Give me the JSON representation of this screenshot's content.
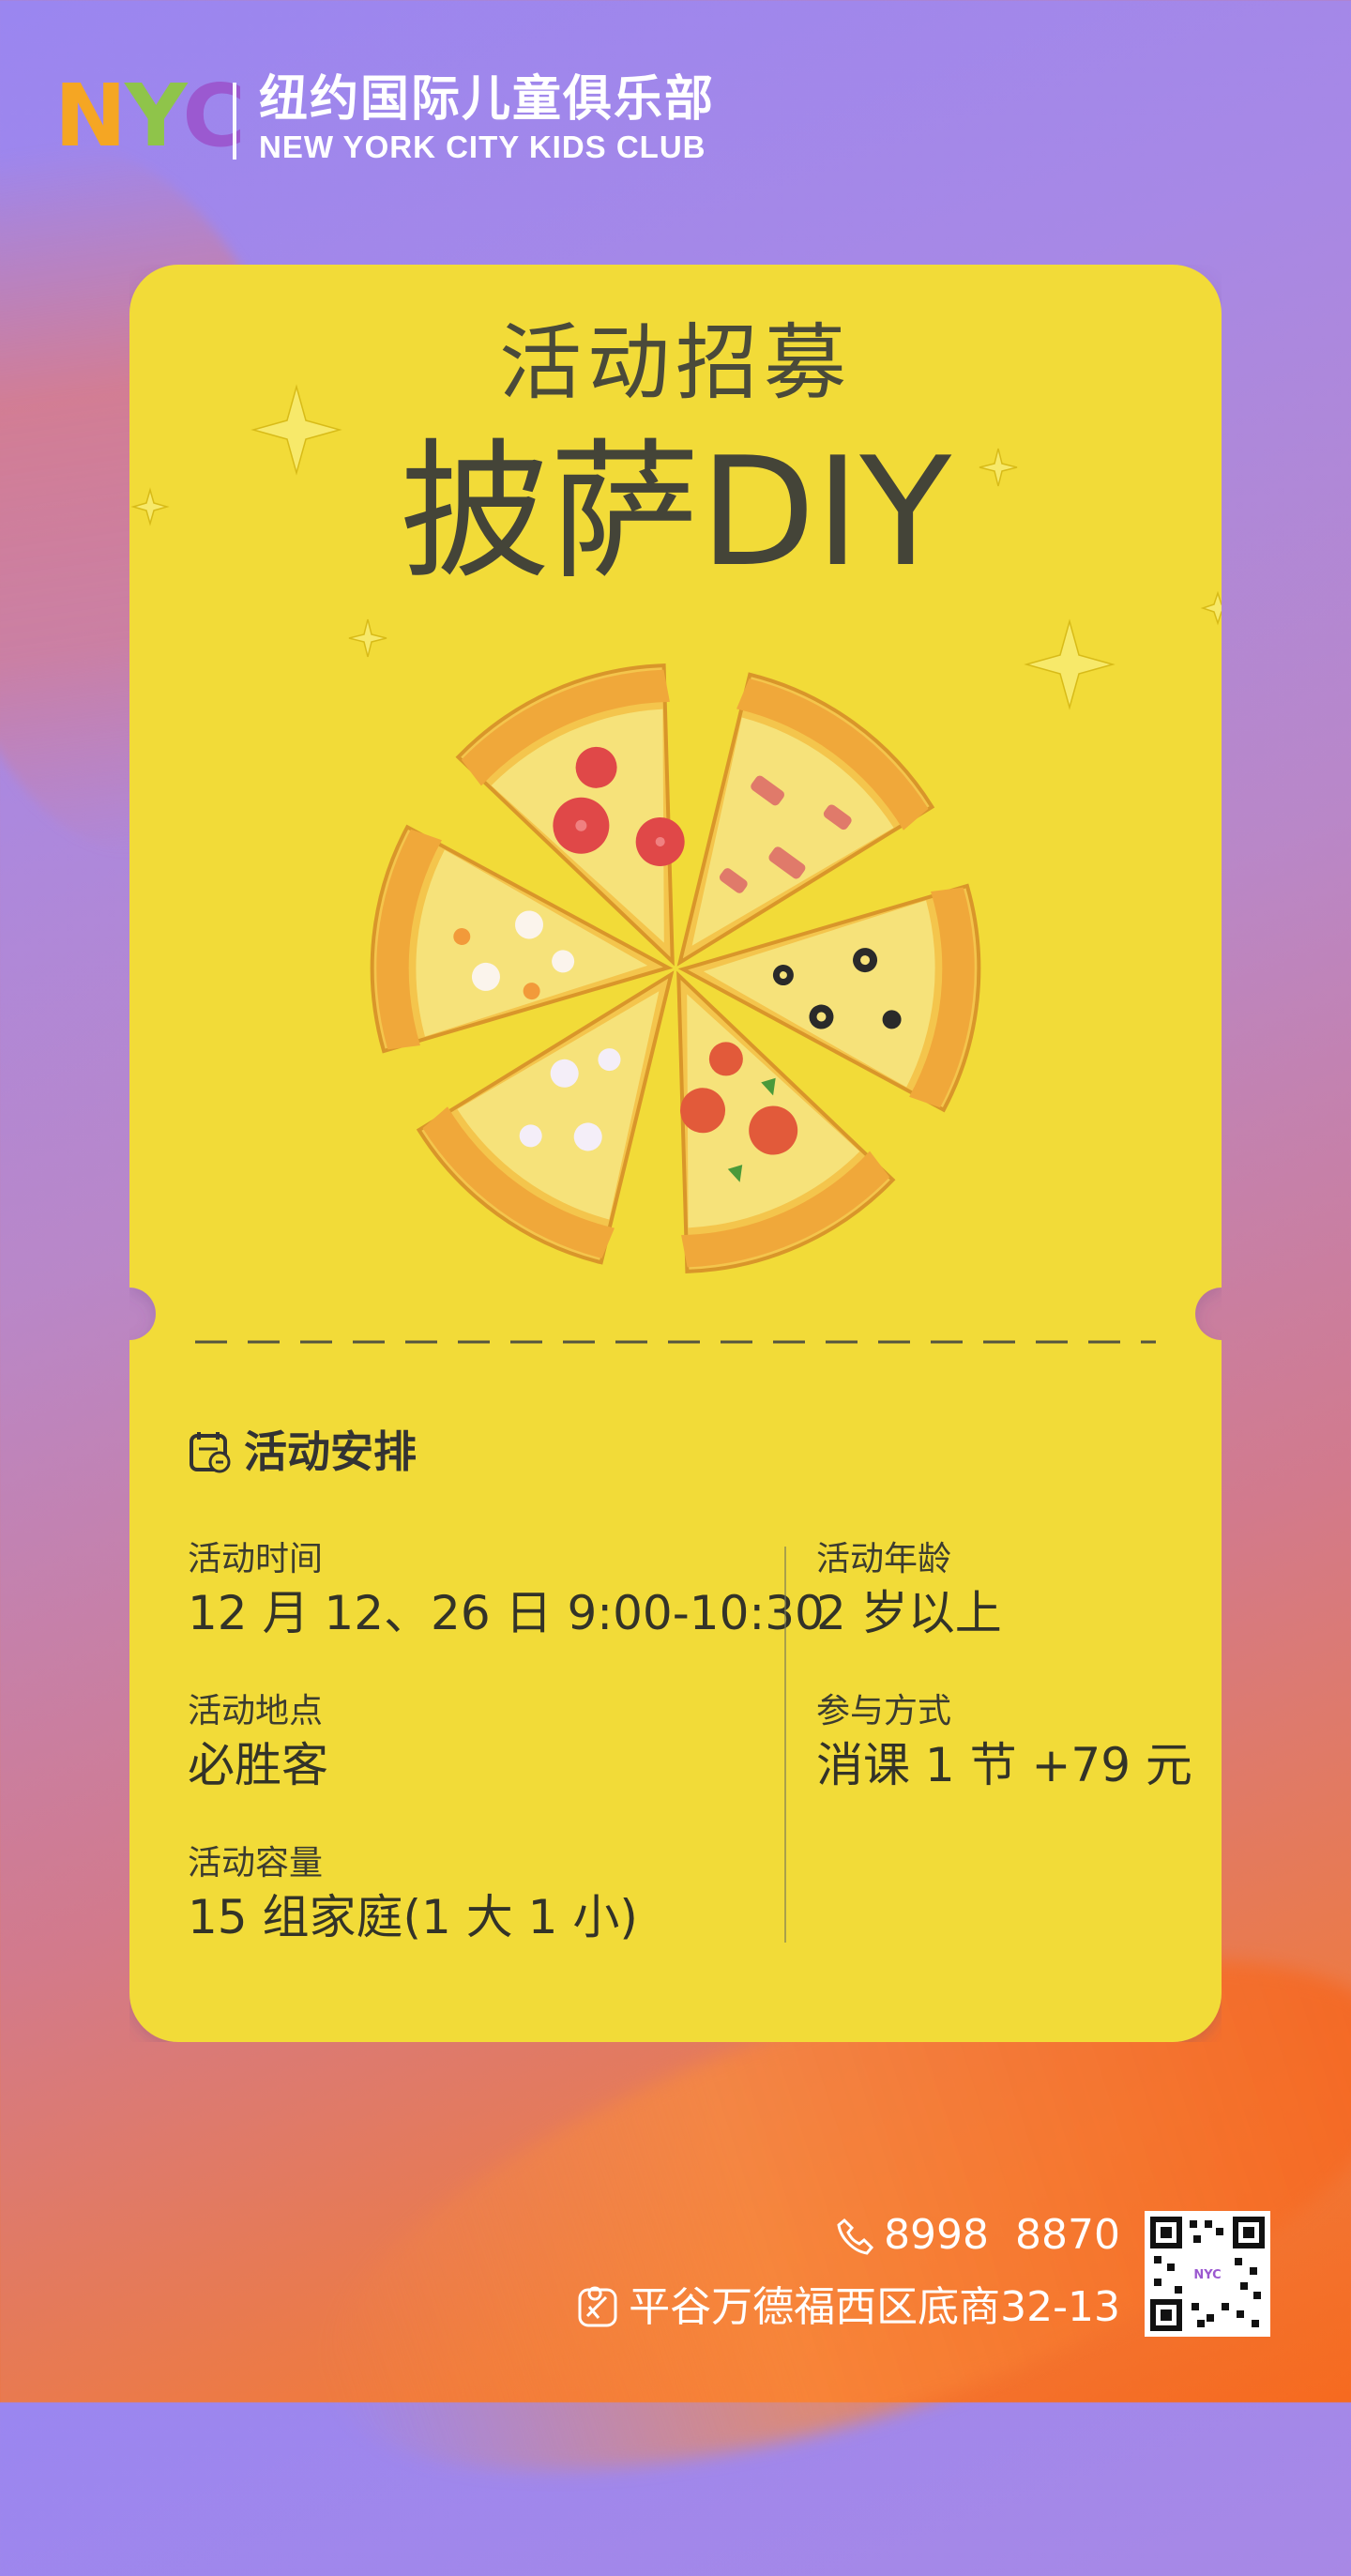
{
  "brand": {
    "logo_text": "NYC",
    "name_cn": "纽约国际儿童俱乐部",
    "name_en": "NEW YORK CITY KIDS CLUB",
    "colors": {
      "n": "#f5a623",
      "y": "#8fc44a",
      "c": "#9b59d0"
    }
  },
  "poster": {
    "kicker": "活动招募",
    "title": "披萨DIY",
    "ticket_color": "#f2db37",
    "illustration": "pizza-slices"
  },
  "schedule": {
    "heading": "活动安排",
    "icon": "calendar-chat-icon",
    "time_label": "活动时间",
    "time_value": "12 月 12、26 日 9:00-10:30",
    "location_label": "活动地点",
    "location_value": "必胜客",
    "capacity_label": "活动容量",
    "capacity_value": "15 组家庭(1 大 1 小)",
    "age_label": "活动年龄",
    "age_value": "2 岁以上",
    "join_label": "参与方式",
    "join_value": "消课 1 节 +79 元"
  },
  "contact": {
    "phone": "8998  8870",
    "address": "平谷万德福西区底商32-13",
    "phone_icon": "phone-icon",
    "address_icon": "map-icon",
    "qr_label": "NYC"
  }
}
